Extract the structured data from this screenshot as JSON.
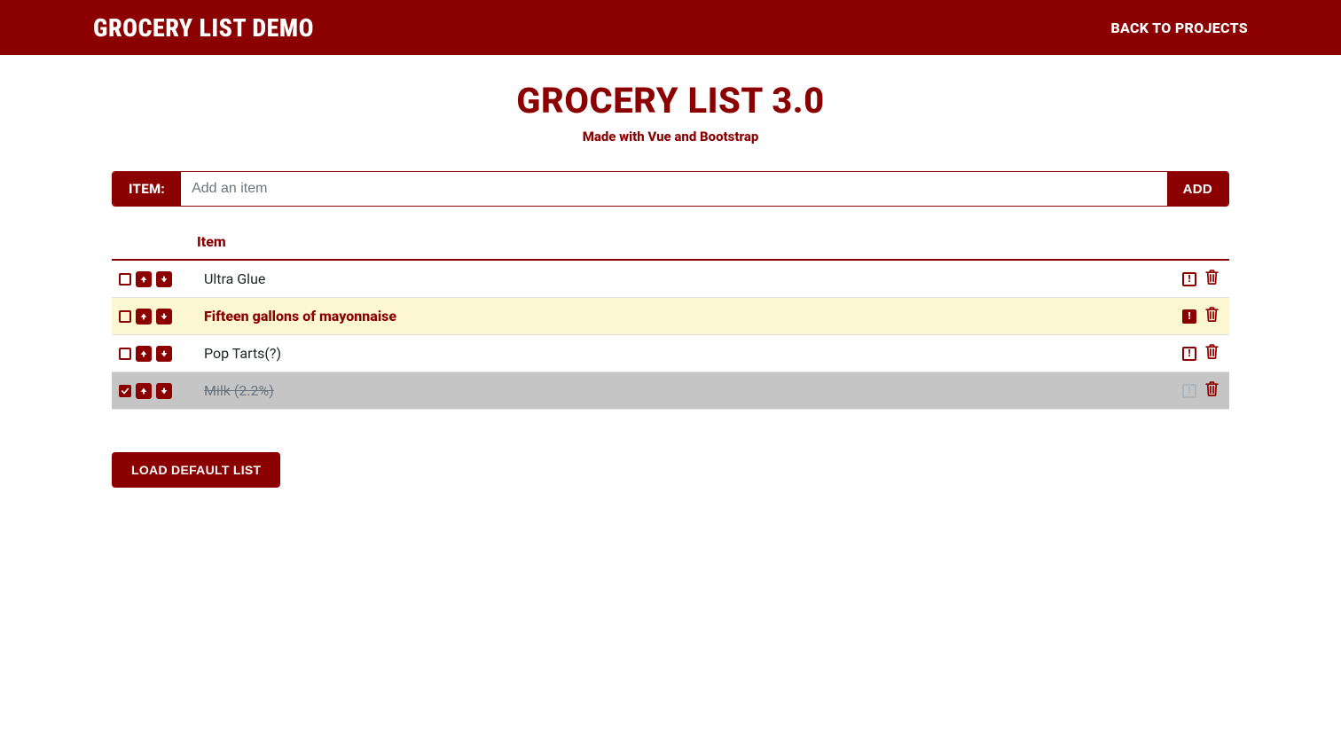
{
  "navbar": {
    "brand": "GROCERY LIST DEMO",
    "back_link": "BACK TO PROJECTS"
  },
  "header": {
    "title": "GROCERY LIST 3.0",
    "subtitle": "Made with Vue and Bootstrap"
  },
  "input": {
    "label": "ITEM:",
    "placeholder": "Add an item",
    "button": "ADD"
  },
  "table": {
    "header": "Item"
  },
  "items": [
    {
      "text": "Ultra Glue",
      "checked": false,
      "priority": false,
      "done": false
    },
    {
      "text": "Fifteen gallons of mayonnaise",
      "checked": false,
      "priority": true,
      "done": false
    },
    {
      "text": "Pop Tarts(?)",
      "checked": false,
      "priority": false,
      "done": false
    },
    {
      "text": "Milk (2.2%)",
      "checked": true,
      "priority": false,
      "done": true
    }
  ],
  "footer": {
    "load_button": "LOAD DEFAULT LIST"
  }
}
